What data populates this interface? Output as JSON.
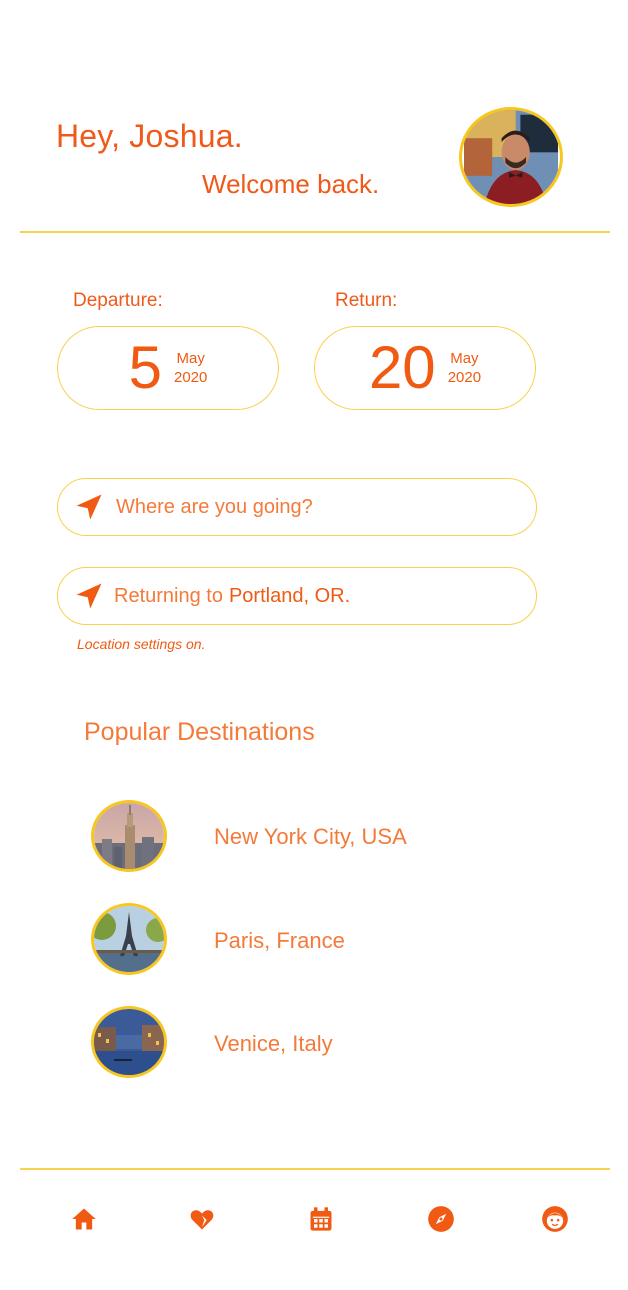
{
  "header": {
    "greeting": "Hey, Joshua.",
    "welcome": "Welcome back."
  },
  "dates": {
    "departure": {
      "label": "Departure:",
      "day": "5",
      "month": "May",
      "year": "2020"
    },
    "return": {
      "label": "Return:",
      "day": "20",
      "month": "May",
      "year": "2020"
    }
  },
  "search": {
    "placeholder": "Where are you going?"
  },
  "returning": {
    "prefix": "Returning to",
    "city": "Portland, OR."
  },
  "location_note": "Location settings on.",
  "popular": {
    "title": "Popular Destinations",
    "items": [
      {
        "name": "New York City, USA",
        "image": "new-york-skyline"
      },
      {
        "name": "Paris, France",
        "image": "eiffel-tower"
      },
      {
        "name": "Venice, Italy",
        "image": "venice-canal"
      }
    ]
  },
  "nav": {
    "items": [
      "home-icon",
      "heart-icon",
      "calendar-icon",
      "compass-icon",
      "profile-icon"
    ]
  },
  "colors": {
    "accent": "#f05a12",
    "border": "#f8d24d",
    "ring": "#f7c71f"
  }
}
